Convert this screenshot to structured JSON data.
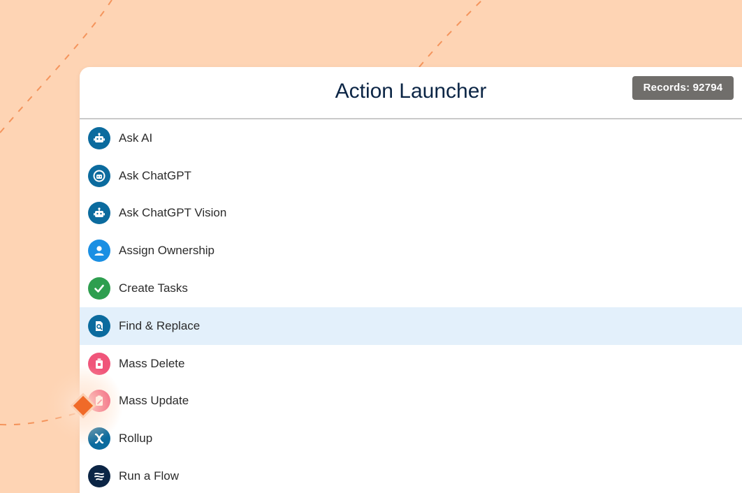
{
  "header": {
    "title": "Action Launcher",
    "records_badge": "Records: 92794"
  },
  "actions": [
    {
      "label": "Ask AI",
      "icon": "robot-icon",
      "color": "#0b6b9e"
    },
    {
      "label": "Ask ChatGPT",
      "icon": "chat-bot-icon",
      "color": "#0b6b9e"
    },
    {
      "label": "Ask ChatGPT Vision",
      "icon": "robot-icon",
      "color": "#0b6b9e"
    },
    {
      "label": "Assign Ownership",
      "icon": "user-icon",
      "color": "#1a8fe3"
    },
    {
      "label": "Create Tasks",
      "icon": "check-icon",
      "color": "#2e9e4f"
    },
    {
      "label": "Find & Replace",
      "icon": "find-replace-icon",
      "color": "#0b6b9e",
      "selected": true
    },
    {
      "label": "Mass Delete",
      "icon": "trash-icon",
      "color": "#f0557a"
    },
    {
      "label": "Mass Update",
      "icon": "clipboard-edit-icon",
      "color": "#f0557a"
    },
    {
      "label": "Rollup",
      "icon": "rollup-icon",
      "color": "#0b6b9e"
    },
    {
      "label": "Run a Flow",
      "icon": "flow-icon",
      "color": "#0b2545"
    }
  ],
  "colors": {
    "background": "#fed4b4",
    "curve": "#f4945c",
    "selected_row": "#e3f0fb",
    "badge": "#706e6b",
    "pointer": "#f06a28"
  }
}
